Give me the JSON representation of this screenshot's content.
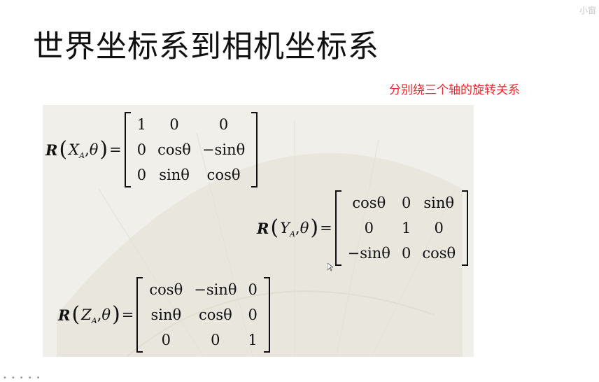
{
  "slide": {
    "title": "世界坐标系到相机坐标系",
    "subtitle": "分别绕三个轴的旋转关系",
    "corner_mark": "小窗"
  },
  "equations": [
    {
      "id": "rx",
      "R": "R",
      "axis": "X",
      "sub": "A",
      "theta": "θ",
      "eq": "=",
      "rows": [
        [
          "1",
          "0",
          "0"
        ],
        [
          "0",
          "cosθ",
          "−sinθ"
        ],
        [
          "0",
          "sinθ",
          "cosθ"
        ]
      ]
    },
    {
      "id": "ry",
      "R": "R",
      "axis": "Y",
      "sub": "A",
      "theta": "θ",
      "eq": "=",
      "rows": [
        [
          "cosθ",
          "0",
          "sinθ"
        ],
        [
          "0",
          "1",
          "0"
        ],
        [
          "−sinθ",
          "0",
          "cosθ"
        ]
      ]
    },
    {
      "id": "rz",
      "R": "R",
      "axis": "Z",
      "sub": "A",
      "theta": "θ",
      "eq": "=",
      "rows": [
        [
          "cosθ",
          "−sinθ",
          "0"
        ],
        [
          "sinθ",
          "cosθ",
          "0"
        ],
        [
          "0",
          "0",
          "1"
        ]
      ]
    }
  ]
}
